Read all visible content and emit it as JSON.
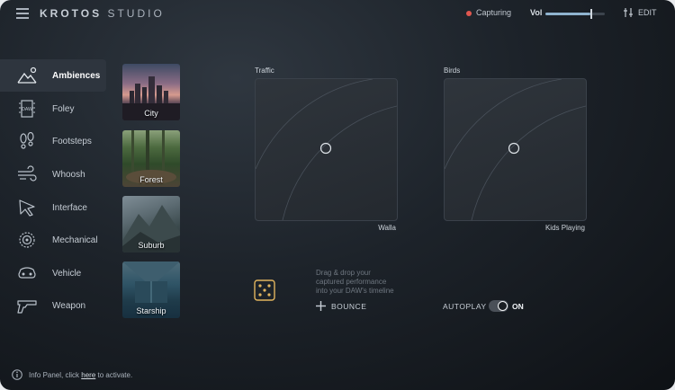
{
  "header": {
    "logo_primary": "KROTOS",
    "logo_secondary": "STUDIO",
    "status": "Capturing",
    "volume_label": "Vol",
    "volume_level": 0.75,
    "edit_label": "EDIT"
  },
  "sidebar": {
    "items": [
      {
        "label": "Ambiences",
        "icon": "mountain-sun-icon",
        "active": true
      },
      {
        "label": "Foley",
        "icon": "foley-film-icon",
        "active": false
      },
      {
        "label": "Footsteps",
        "icon": "footsteps-icon",
        "active": false
      },
      {
        "label": "Whoosh",
        "icon": "wind-icon",
        "active": false
      },
      {
        "label": "Interface",
        "icon": "cursor-arrow-icon",
        "active": false
      },
      {
        "label": "Mechanical",
        "icon": "gear-icon",
        "active": false
      },
      {
        "label": "Vehicle",
        "icon": "vehicle-icon",
        "active": false
      },
      {
        "label": "Weapon",
        "icon": "gun-icon",
        "active": false
      }
    ]
  },
  "presets": [
    {
      "label": "City"
    },
    {
      "label": "Forest"
    },
    {
      "label": "Suburb"
    },
    {
      "label": "Starship"
    }
  ],
  "pads": [
    {
      "title": "Traffic",
      "subtitle": "Walla"
    },
    {
      "title": "Birds",
      "subtitle": "Kids Playing"
    }
  ],
  "controls": {
    "drag_line1": "Drag & drop your",
    "drag_line2": "captured performance",
    "drag_line3": "into your DAW's timeline",
    "bounce_label": "BOUNCE",
    "autoplay_label": "AUTOPLAY",
    "autoplay_state": "ON"
  },
  "footer": {
    "info_prefix": "Info Panel, click ",
    "info_link": "here",
    "info_suffix": " to activate."
  },
  "colors": {
    "status_dot": "#e0574f",
    "volume_fill": "#8fb3cf",
    "dice_accent": "#e2b55e"
  }
}
